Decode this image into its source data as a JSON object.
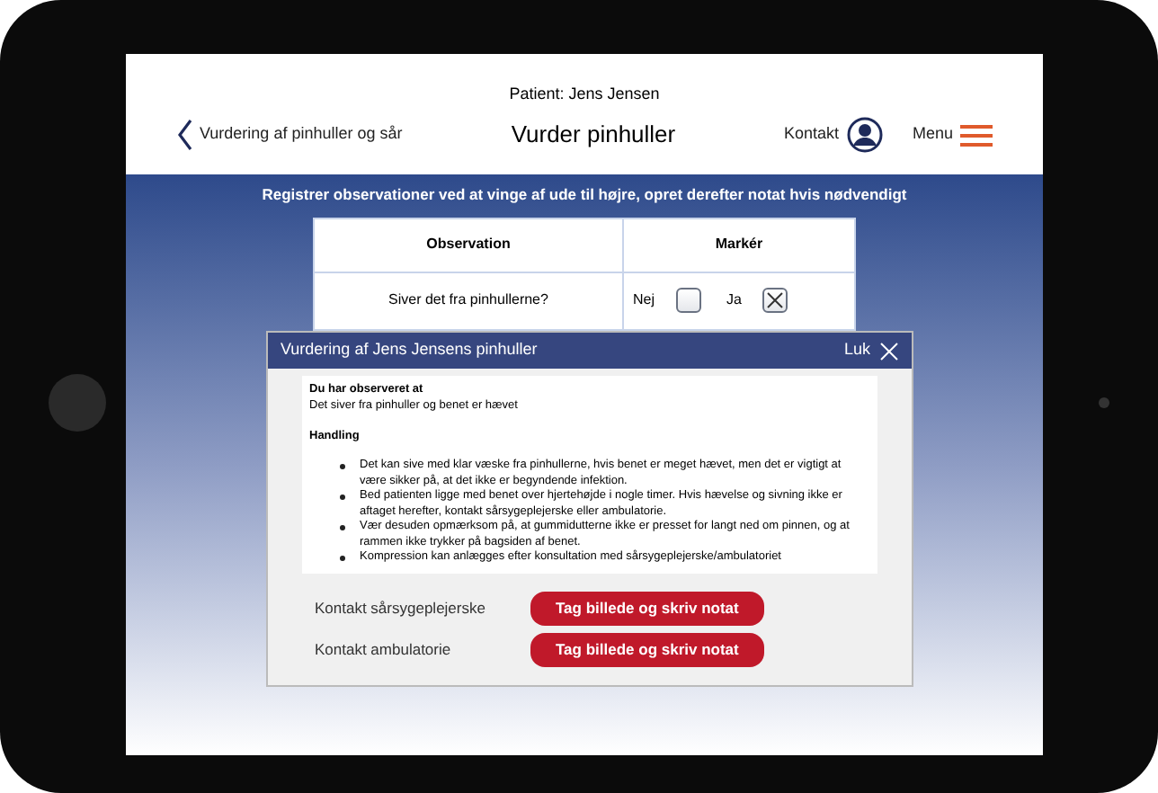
{
  "header": {
    "patient": "Patient: Jens Jensen",
    "back_label": "Vurdering af pinhuller og sår",
    "title": "Vurder pinhuller",
    "contact": "Kontakt",
    "menu": "Menu"
  },
  "instruction": "Registrer observationer ved at vinge af ude til højre, opret derefter notat hvis nødvendigt",
  "table": {
    "columns": [
      "Observation",
      "Markér"
    ],
    "rows": [
      {
        "question": "Siver det fra pinhullerne?",
        "options": [
          {
            "label": "Nej",
            "checked": false
          },
          {
            "label": "Ja",
            "checked": true
          }
        ]
      }
    ]
  },
  "dialog": {
    "title": "Vurdering af Jens Jensens pinhuller",
    "close": "Luk",
    "observed_heading": "Du har observeret at",
    "observed_text": "Det siver fra pinhuller og benet er hævet",
    "action_heading": "Handling",
    "actions": [
      "Det kan sive med klar væske fra pinhullerne, hvis benet er meget hævet, men det er vigtigt at være sikker på, at det ikke er begyndende infektion.",
      "Bed patienten ligge med benet over hjertehøjde i nogle timer. Hvis hævelse og sivning ikke er aftaget herefter, kontakt sårsygeplejerske eller ambulatorie.",
      "Vær desuden opmærksom på, at gummidutterne ikke er presset for langt ned om pinnen, og at rammen ikke trykker på bagsiden af benet.",
      "Kompression kan anlægges efter konsultation med sårsygeplejerske/ambulatoriet"
    ],
    "contacts": [
      {
        "label": "Kontakt sårsygeplejerske",
        "button": "Tag billede og skriv notat"
      },
      {
        "label": "Kontakt ambulatorie",
        "button": "Tag billede og skriv notat"
      }
    ]
  }
}
